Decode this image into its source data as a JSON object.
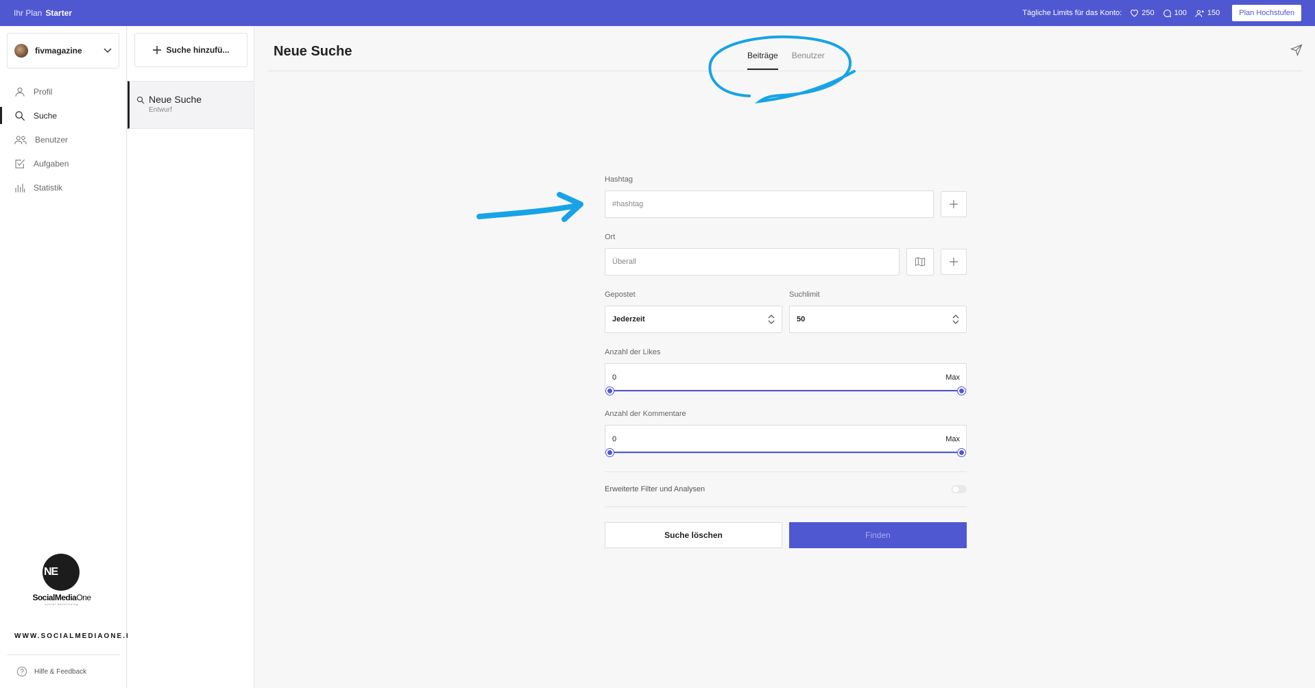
{
  "topbar": {
    "plan_label": "Ihr Plan",
    "plan_name": "Starter",
    "limits_label": "Tägliche Limits für das Konto:",
    "likes_limit": "250",
    "comments_limit": "100",
    "follows_limit": "150",
    "upgrade_label": "Plan Hochstufen"
  },
  "sidebar": {
    "account_name": "fivmagazine",
    "items": [
      {
        "label": "Profil",
        "icon": "user-icon"
      },
      {
        "label": "Suche",
        "icon": "search-icon"
      },
      {
        "label": "Benutzer",
        "icon": "users-icon"
      },
      {
        "label": "Aufgaben",
        "icon": "tasks-icon"
      },
      {
        "label": "Statistik",
        "icon": "stats-icon"
      }
    ],
    "logo_initials": "NE",
    "logo_brand": "SocialMedia",
    "logo_brand_suffix": "One",
    "logo_tagline": "social advertising",
    "website": "WWW.SOCIALMEDIAONE.DE",
    "help_label": "Hilfe & Feedback"
  },
  "searches": {
    "add_label": "Suche hinzufü...",
    "entry_title": "Neue Suche",
    "entry_status": "Entwurf"
  },
  "main": {
    "title": "Neue Suche",
    "tabs": [
      "Beiträge",
      "Benutzer"
    ],
    "active_tab": "Beiträge"
  },
  "form": {
    "hashtag_label": "Hashtag",
    "hashtag_placeholder": "#hashtag",
    "location_label": "Ort",
    "location_placeholder": "Überall",
    "posted_label": "Gepostet",
    "posted_value": "Jederzeit",
    "limit_label": "Suchlimit",
    "limit_value": "50",
    "likes_label": "Anzahl der Likes",
    "likes_min": "0",
    "likes_max": "Max",
    "comments_label": "Anzahl der Kommentare",
    "comments_min": "0",
    "comments_max": "Max",
    "advanced_label": "Erweiterte Filter und Analysen",
    "clear_label": "Suche löschen",
    "find_label": "Finden"
  },
  "colors": {
    "accent": "#4f57d1",
    "annotation": "#17a3e6"
  }
}
